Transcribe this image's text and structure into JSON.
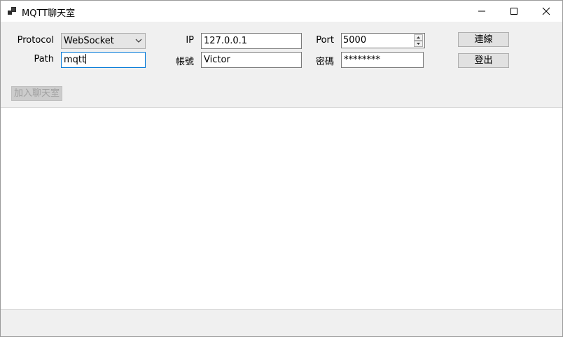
{
  "window": {
    "title": "MQTT聊天室",
    "icon": "app-icon",
    "controls": [
      "minimize-icon",
      "maximize-icon",
      "close-icon"
    ]
  },
  "form": {
    "protocol_label": "Protocol",
    "protocol_value": "WebSocket",
    "ip_label": "IP",
    "ip_value": "127.0.0.1",
    "port_label": "Port",
    "port_value": "5000",
    "path_label": "Path",
    "path_value": "mqtt",
    "account_label": "帳號",
    "account_value": "Victor",
    "password_label": "密碼",
    "password_value": "********"
  },
  "buttons": {
    "connect": "連線",
    "logout": "登出",
    "join_chat": "加入聊天室"
  },
  "chat": {
    "messages": []
  }
}
